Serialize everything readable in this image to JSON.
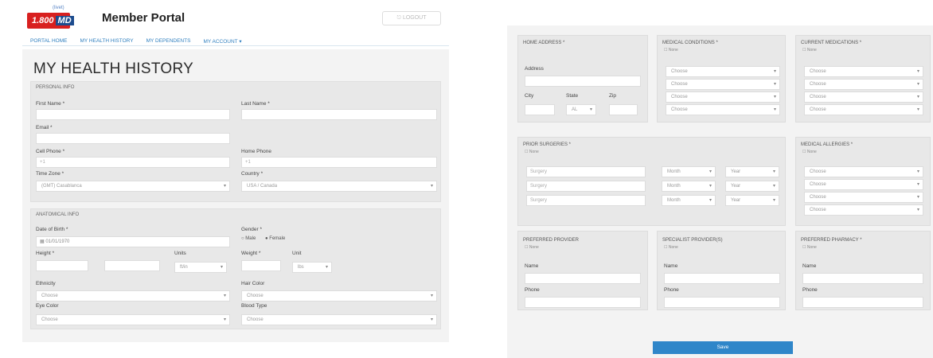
{
  "header": {
    "logo_text": "1.800",
    "logo_md": "MD",
    "logo_sup": "(livet)",
    "portal_title": "Member Portal",
    "logout": "LOGOUT"
  },
  "nav": [
    "PORTAL HOME",
    "MY HEALTH HISTORY",
    "MY DEPENDENTS",
    "MY ACCOUNT ▾"
  ],
  "page_title": "MY HEALTH HISTORY",
  "personal": {
    "section": "PERSONAL INFO",
    "first_name": "First Name *",
    "last_name": "Last Name *",
    "email": "Email *",
    "cell_phone": "Cell Phone *",
    "cell_value": "+1",
    "home_phone": "Home Phone",
    "home_value": "+1",
    "time_zone": "Time Zone *",
    "time_zone_value": "(GMT) Casablanca",
    "country": "Country *",
    "country_value": "USA / Canada"
  },
  "anatomical": {
    "section": "ANATOMICAL INFO",
    "dob": "Date of Birth *",
    "dob_value": "01/01/1970",
    "gender": "Gender *",
    "male": "Male",
    "female": "Female",
    "height": "Height *",
    "units": "Units",
    "units_value": "ft/in",
    "weight": "Weight *",
    "unit": "Unit",
    "unit_value": "lbs",
    "ethnicity": "Ethnicity",
    "ethnicity_value": "Choose",
    "hair": "Hair Color",
    "hair_value": "Choose",
    "eye": "Eye Color",
    "eye_value": "Choose",
    "blood": "Blood Type",
    "blood_value": "Choose"
  },
  "right": {
    "home_address": "HOME ADDRESS *",
    "address": "Address",
    "city": "City",
    "state": "State",
    "state_value": "AL",
    "zip": "Zip",
    "medical_conditions": "MEDICAL CONDITIONS *",
    "current_medications": "CURRENT MEDICATIONS *",
    "none": "None",
    "choose": "Choose",
    "prior_surgeries": "PRIOR SURGERIES *",
    "surgery": "Surgery",
    "month": "Month",
    "year": "Year",
    "medical_allergies": "MEDICAL ALLERGIES *",
    "preferred_providers": "PREFERRED PROVIDER",
    "specialist_providers": "SPECIALIST PROVIDER(S)",
    "preferred_pharmacy": "PREFERRED PHARMACY *",
    "name": "Name",
    "phone": "Phone",
    "save": "Save"
  }
}
